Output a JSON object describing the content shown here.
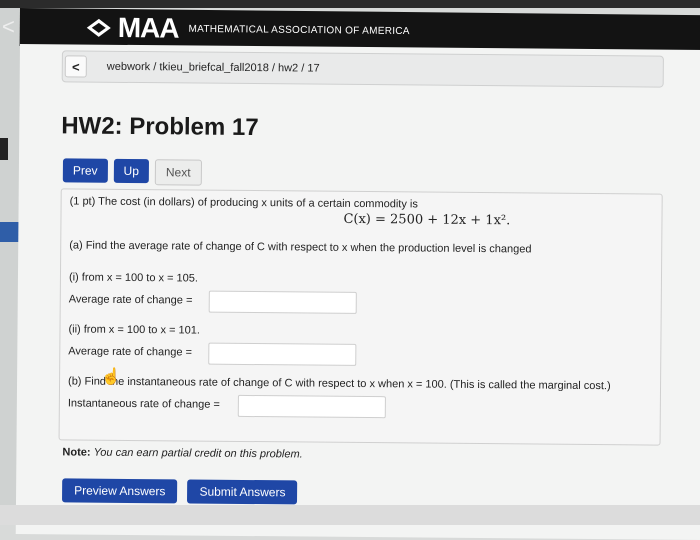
{
  "header": {
    "logo_text": "MAA",
    "subtitle": "MATHEMATICAL ASSOCIATION OF AMERICA",
    "back_glyph": "<"
  },
  "breadcrumb": {
    "back_glyph": "<",
    "path": "webwork / tkieu_briefcal_fall2018 / hw2 / 17"
  },
  "page": {
    "title": "HW2: Problem 17"
  },
  "nav": {
    "prev": "Prev",
    "up": "Up",
    "next": "Next"
  },
  "problem": {
    "intro": "(1 pt) The cost (in dollars) of producing x units of a certain commodity is",
    "formula": "C(x) = 2500 + 12x + 1x².",
    "part_a": "(a) Find the average rate of change of C with respect to x when the production level is changed",
    "part_a_i": "(i) from x = 100 to x = 105.",
    "avg_rate_label_1": "Average rate of change =",
    "part_a_ii": "(ii) from x = 100 to x = 101.",
    "avg_rate_label_2": "Average rate of change =",
    "part_b": "(b) Find the instantaneous rate of change of C with respect to x when x = 100. (This is called the marginal cost.)",
    "inst_rate_label": "Instantaneous rate of change ="
  },
  "note": {
    "label": "Note:",
    "text": "You can earn partial credit on this problem."
  },
  "actions": {
    "preview": "Preview Answers",
    "submit": "Submit Answers"
  },
  "colors": {
    "primary": "#1f47a6",
    "header_bg": "#131313"
  }
}
